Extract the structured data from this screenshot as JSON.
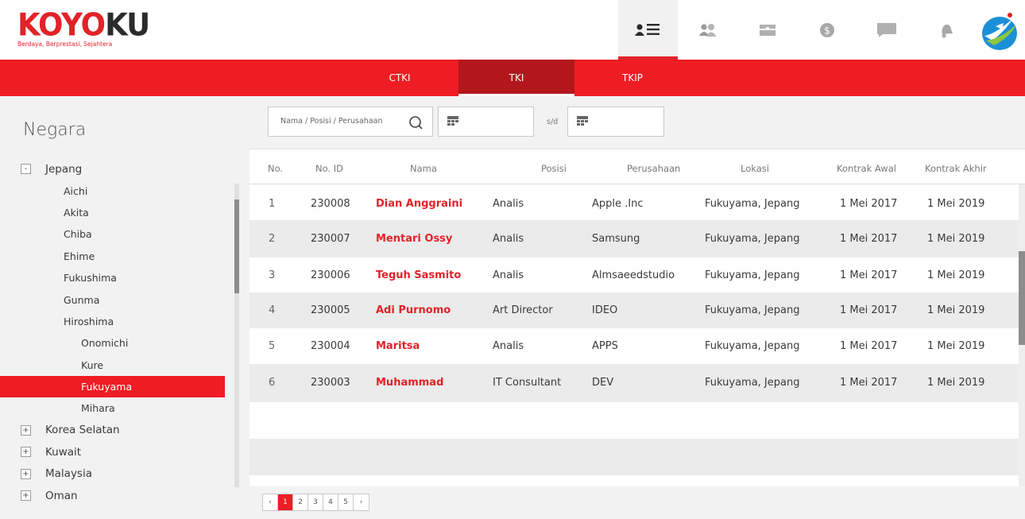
{
  "brand": {
    "logo_part1": "KOYO",
    "logo_part2": "KU",
    "tagline": "Berdaya, Berprestasi, Sejahtera"
  },
  "topnav": {
    "items": [
      "list-icon",
      "people-icon",
      "card-icon",
      "dollar-icon",
      "chat-icon",
      "bell-icon",
      "brand-logo-icon"
    ],
    "active_index": 0
  },
  "tabs": [
    {
      "label": "CTKI"
    },
    {
      "label": "TKI"
    },
    {
      "label": "TKIP"
    }
  ],
  "active_tab": "TKI",
  "sidebar": {
    "title": "Negara",
    "tree": [
      {
        "label": "Jepang",
        "level": 0,
        "toggle": "-"
      },
      {
        "label": "Aichi",
        "level": 1
      },
      {
        "label": "Akita",
        "level": 1
      },
      {
        "label": "Chiba",
        "level": 1
      },
      {
        "label": "Ehime",
        "level": 1
      },
      {
        "label": "Fukushima",
        "level": 1
      },
      {
        "label": "Gunma",
        "level": 1
      },
      {
        "label": "Hiroshima",
        "level": 1
      },
      {
        "label": "Onomichi",
        "level": 2
      },
      {
        "label": "Kure",
        "level": 2
      },
      {
        "label": "Fukuyama",
        "level": 2,
        "selected": true
      },
      {
        "label": "Mihara",
        "level": 2
      },
      {
        "label": "Korea Selatan",
        "level": 0,
        "toggle": "+"
      },
      {
        "label": "Kuwait",
        "level": 0,
        "toggle": "+"
      },
      {
        "label": "Malaysia",
        "level": 0,
        "toggle": "+"
      },
      {
        "label": "Oman",
        "level": 0,
        "toggle": "+"
      }
    ]
  },
  "filters": {
    "search_placeholder": "Nama / Posisi / Perusahaan",
    "date_separator": "s/d",
    "date_from": "",
    "date_to": ""
  },
  "table": {
    "headers": [
      "No.",
      "No. ID",
      "Nama",
      "Posisi",
      "Perusahaan",
      "Lokasi",
      "Kontrak Awal",
      "Kontrak Akhir"
    ],
    "rows": [
      [
        "1",
        "230008",
        "Dian Anggraini",
        "Analis",
        "Apple .Inc",
        "Fukuyama, Jepang",
        "1 Mei 2017",
        "1 Mei 2019"
      ],
      [
        "2",
        "230007",
        "Mentari Ossy",
        "Analis",
        "Samsung",
        "Fukuyama, Jepang",
        "1 Mei 2017",
        "1 Mei 2019"
      ],
      [
        "3",
        "230006",
        "Teguh Sasmito",
        "Analis",
        "Almsaeedstudio",
        "Fukuyama, Jepang",
        "1 Mei 2017",
        "1 Mei 2019"
      ],
      [
        "4",
        "230005",
        "Adi Purnomo",
        "Art Director",
        "IDEO",
        "Fukuyama, Jepang",
        "1 Mei 2017",
        "1 Mei 2019"
      ],
      [
        "5",
        "230004",
        "Maritsa",
        "Analis",
        "APPS",
        "Fukuyama, Jepang",
        "1 Mei 2017",
        "1 Mei 2019"
      ],
      [
        "6",
        "230003",
        "Muhammad",
        "IT Consultant",
        "DEV",
        "Fukuyama, Jepang",
        "1 Mei 2017",
        "1 Mei 2019"
      ]
    ]
  },
  "pagination": {
    "prev": "‹",
    "pages": [
      "1",
      "2",
      "3",
      "4",
      "5"
    ],
    "current": "1",
    "next": "›"
  },
  "colors": {
    "accent": "#ee1d23",
    "accent_dark": "#b3171c",
    "text": "#3a3a3a"
  }
}
